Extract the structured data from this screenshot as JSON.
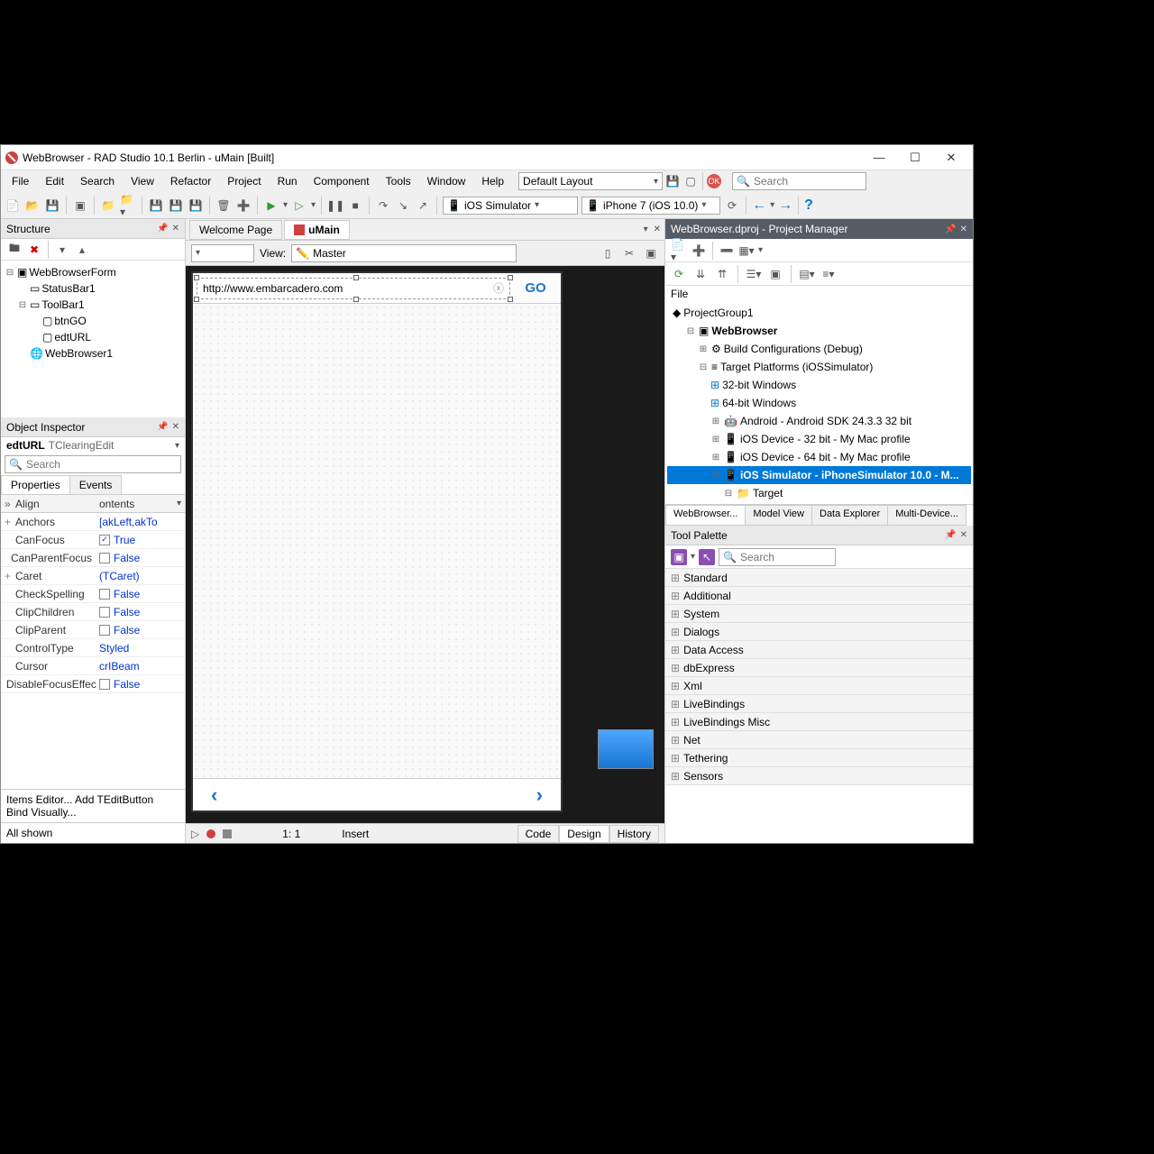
{
  "window": {
    "title": "WebBrowser - RAD Studio 10.1 Berlin - uMain [Built]"
  },
  "menu": [
    "File",
    "Edit",
    "Search",
    "View",
    "Refactor",
    "Project",
    "Run",
    "Component",
    "Tools",
    "Window",
    "Help"
  ],
  "layout": {
    "label": "Default Layout"
  },
  "topsearch": {
    "placeholder": "Search"
  },
  "targets": {
    "platform": "iOS Simulator",
    "device": "iPhone 7 (iOS 10.0)"
  },
  "doctabs": {
    "welcome": "Welcome Page",
    "main": "uMain"
  },
  "viewbar": {
    "label": "View:",
    "value": "Master"
  },
  "designer": {
    "url": "http://www.embarcadero.com",
    "go": "GO"
  },
  "status": {
    "pos": "1: 1",
    "mode": "Insert"
  },
  "viewtabs": {
    "code": "Code",
    "design": "Design",
    "history": "History"
  },
  "structure": {
    "title": "Structure",
    "root": "WebBrowserForm",
    "children": [
      "StatusBar1",
      "ToolBar1",
      "WebBrowser1"
    ],
    "toolbar_children": [
      "btnGO",
      "edtURL"
    ]
  },
  "objinsp": {
    "title": "Object Inspector",
    "sel_name": "edtURL",
    "sel_type": "TClearingEdit",
    "search_placeholder": "Search",
    "tab_props": "Properties",
    "tab_events": "Events",
    "colhdr1": "Align",
    "colhdr2": "ontents",
    "props": [
      {
        "n": "Anchors",
        "v": "[akLeft,akTo",
        "exp": "+",
        "link": true
      },
      {
        "n": "CanFocus",
        "v": "True",
        "cb": true,
        "checked": true
      },
      {
        "n": "CanParentFocus",
        "v": "False",
        "cb": true
      },
      {
        "n": "Caret",
        "v": "(TCaret)",
        "exp": "+",
        "link": true
      },
      {
        "n": "CheckSpelling",
        "v": "False",
        "cb": true
      },
      {
        "n": "ClipChildren",
        "v": "False",
        "cb": true
      },
      {
        "n": "ClipParent",
        "v": "False",
        "cb": true
      },
      {
        "n": "ControlType",
        "v": "Styled",
        "link": true
      },
      {
        "n": "Cursor",
        "v": "crIBeam",
        "link": true
      },
      {
        "n": "DisableFocusEffec",
        "v": "False",
        "cb": true
      }
    ],
    "links": "Items Editor...   Add TEditButton",
    "bind": "Bind Visually...",
    "status": "All shown"
  },
  "projmgr": {
    "title": "WebBrowser.dproj - Project Manager",
    "filelbl": "File",
    "group": "ProjectGroup1",
    "project": "WebBrowser",
    "build": "Build Configurations (Debug)",
    "targets_lbl": "Target Platforms (iOSSimulator)",
    "platforms": [
      "32-bit Windows",
      "64-bit Windows",
      "Android - Android SDK 24.3.3 32 bit",
      "iOS Device - 32 bit - My Mac profile",
      "iOS Device - 64 bit - My Mac profile",
      "iOS Simulator - iPhoneSimulator 10.0 - M..."
    ],
    "target_sub": "Target",
    "tabs": [
      "WebBrowser...",
      "Model View",
      "Data Explorer",
      "Multi-Device..."
    ]
  },
  "palette": {
    "title": "Tool Palette",
    "search_placeholder": "Search",
    "cats": [
      "Standard",
      "Additional",
      "System",
      "Dialogs",
      "Data Access",
      "dbExpress",
      "Xml",
      "LiveBindings",
      "LiveBindings Misc",
      "Net",
      "Tethering",
      "Sensors"
    ]
  }
}
